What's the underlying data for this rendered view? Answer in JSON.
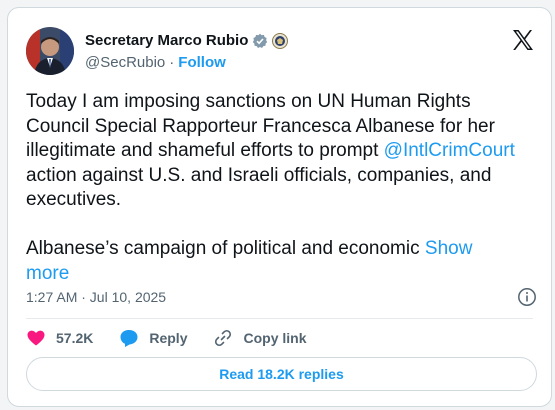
{
  "author": {
    "name": "Secretary Marco Rubio",
    "handle": "@SecRubio",
    "separator": "·",
    "follow_label": "Follow"
  },
  "tweet": {
    "line1_a": "Today I am imposing sanctions on UN Human Rights Council Special Rapporteur Francesca Albanese for her illegitimate and shameful efforts to prompt",
    "mention": "@IntlCrimCourt",
    "line1_b": " action against U.S. and Israeli officials, companies, and executives.",
    "line2": "Albanese’s campaign of political and economic ",
    "show_more": "Show more"
  },
  "timestamp": "1:27 AM · Jul 10, 2025",
  "actions": {
    "likes": "57.2K",
    "reply_label": "Reply",
    "copy_link_label": "Copy link"
  },
  "read_replies_label": "Read 18.2K replies",
  "colors": {
    "accent": "#1d9bf0",
    "like": "#f91880",
    "secondary_text": "#536471"
  }
}
